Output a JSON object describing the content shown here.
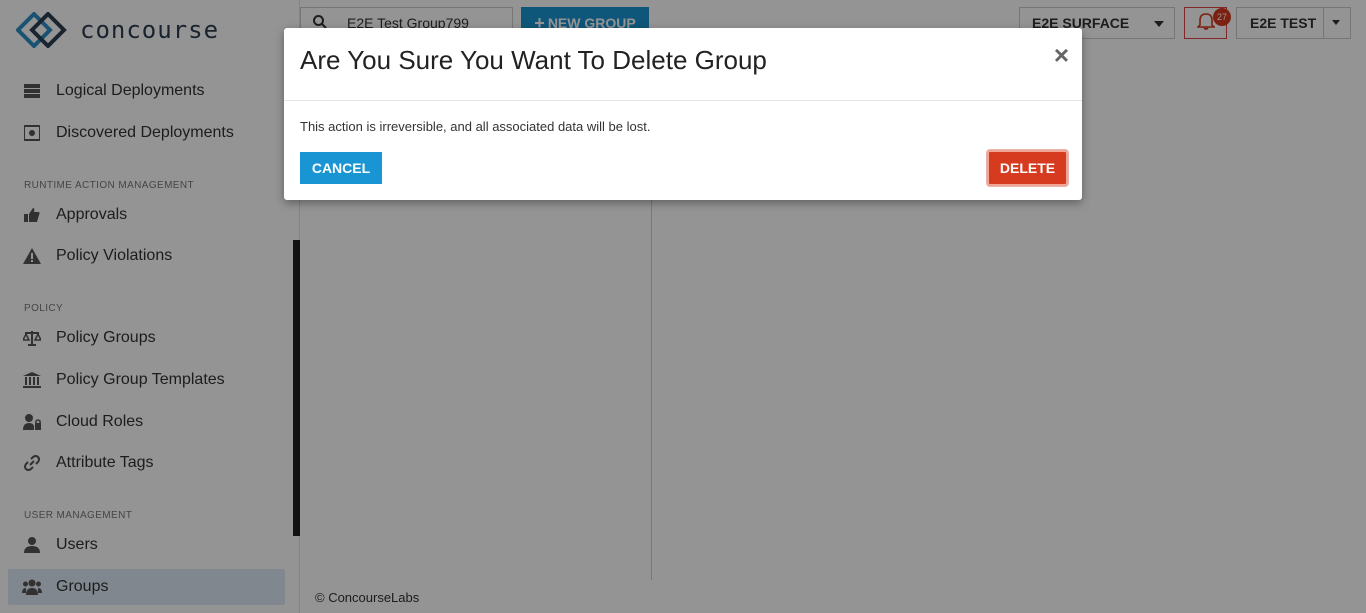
{
  "app": {
    "logo_text": "concourse"
  },
  "sidebar": {
    "items": [
      {
        "label": "Logical Deployments",
        "icon": "server-stack-icon"
      },
      {
        "label": "Discovered Deployments",
        "icon": "discovered-icon"
      },
      {
        "label": "Approvals",
        "icon": "thumbs-up-icon"
      },
      {
        "label": "Policy Violations",
        "icon": "warning-icon"
      },
      {
        "label": "Policy Groups",
        "icon": "balance-scale-icon"
      },
      {
        "label": "Policy Group Templates",
        "icon": "bank-icon"
      },
      {
        "label": "Cloud Roles",
        "icon": "user-lock-icon"
      },
      {
        "label": "Attribute Tags",
        "icon": "link-icon"
      },
      {
        "label": "Users",
        "icon": "user-icon"
      },
      {
        "label": "Groups",
        "icon": "users-icon"
      }
    ],
    "sections": {
      "runtime": "RUNTIME ACTION MANAGEMENT",
      "policy": "POLICY",
      "user_management": "USER MANAGEMENT"
    },
    "active_item": "Groups"
  },
  "topbar": {
    "search_value": "E2E Test Group799",
    "new_group_label": "NEW GROUP",
    "surface_selected": "E2E SURFACE",
    "notification_count": "27",
    "user_label": "E2E TEST"
  },
  "footer": {
    "text": "© ConcourseLabs"
  },
  "modal": {
    "title": "Are You Sure You Want To Delete Group",
    "close_glyph": "×",
    "message": "This action is irreversible, and all associated data will be lost.",
    "cancel_label": "CANCEL",
    "delete_label": "DELETE"
  },
  "colors": {
    "primary": "#1a95d4",
    "danger": "#d63a1f",
    "active_nav": "#dce9f4"
  }
}
